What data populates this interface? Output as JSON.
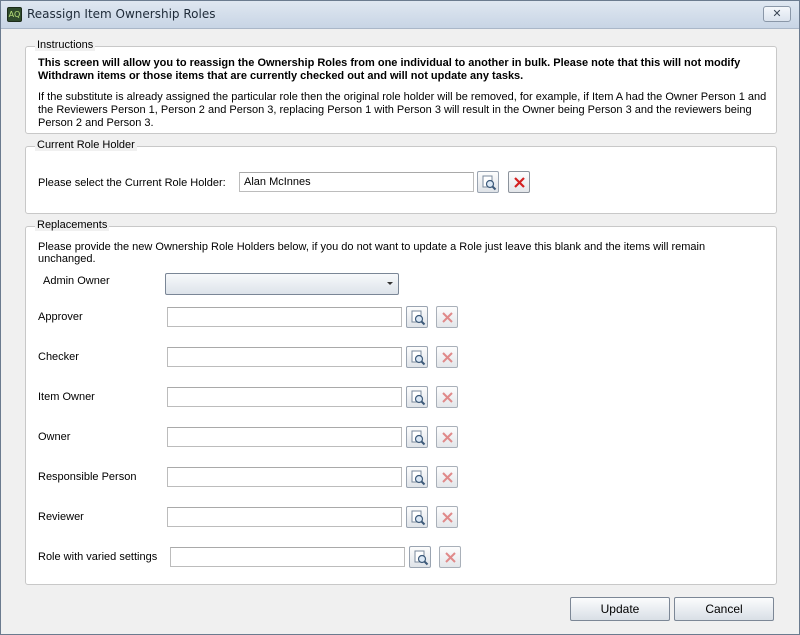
{
  "window": {
    "title": "Reassign Item Ownership Roles",
    "app_icon_text": "AQ",
    "close_glyph": "✕"
  },
  "instructions": {
    "heading": "Instructions",
    "bold_text": "This screen will allow you to reassign the Ownership Roles from one individual to another in bulk. Please note that this will not modify Withdrawn items or those items that are currently checked out and will not update any tasks.",
    "normal_text": "If the substitute is already assigned the particular role then the original role holder will be removed, for example, if Item A had the Owner Person 1 and the Reviewers Person 1, Person 2 and Person 3, replacing Person 1 with Person 3 will result in the Owner being Person 3 and the reviewers being Person 2 and Person 3."
  },
  "current_role_holder": {
    "heading": "Current Role Holder",
    "label": "Please select the Current Role Holder:",
    "value": "Alan McInnes"
  },
  "replacements": {
    "heading": "Replacements",
    "description": "Please provide the new Ownership Role Holders below, if you do not want to update a Role just leave this blank and the items will remain unchanged.",
    "admin_owner_label": "Admin Owner",
    "admin_owner_value": "",
    "roles": [
      {
        "label": "Approver",
        "value": ""
      },
      {
        "label": "Checker",
        "value": ""
      },
      {
        "label": "Item Owner",
        "value": ""
      },
      {
        "label": "Owner",
        "value": ""
      },
      {
        "label": "Responsible Person",
        "value": ""
      },
      {
        "label": "Reviewer",
        "value": ""
      },
      {
        "label": "Role with varied settings",
        "value": ""
      }
    ]
  },
  "buttons": {
    "update": "Update",
    "cancel": "Cancel"
  },
  "colors": {
    "clear_active": "#d42020",
    "clear_inactive": "#e08a8a"
  }
}
